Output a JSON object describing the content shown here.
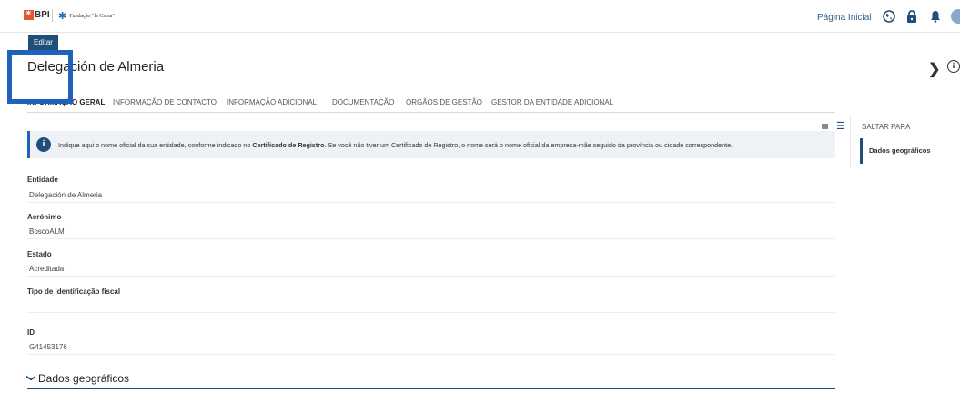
{
  "header": {
    "logo_bpi": "BPI",
    "logo_fundacao": "Fundação \"la Caixa\"",
    "home_link": "Página Inicial"
  },
  "toolbar": {
    "edit_label": "Editar"
  },
  "page": {
    "title": "Delegación de Almeria"
  },
  "tabs": [
    {
      "label": "INFORMAÇÃO GERAL",
      "active": true
    },
    {
      "label": "INFORMAÇÃO DE CONTACTO"
    },
    {
      "label": "INFORMAÇÃO ADICIONAL"
    },
    {
      "label": "DOCUMENTAÇÃO"
    },
    {
      "label": "ÓRGÃOS DE GESTÃO"
    },
    {
      "label": "GESTOR DA ENTIDADE ADICIONAL"
    }
  ],
  "alert": {
    "text_before": "Indique aqui o nome oficial da sua entidade, conforme indicado no ",
    "text_bold": "Certificado de Registro",
    "text_after": ". Se você não tiver um Certificado de Registro, o nome será o nome oficial da empresa-mãe seguido da província ou cidade correspondente."
  },
  "fields": [
    {
      "label": "Entidade",
      "value": "Delegación de Almeria"
    },
    {
      "label": "Acrónimo",
      "value": "BoscoALM"
    },
    {
      "label": "Estado",
      "value": "Acreditada"
    },
    {
      "label": "Tipo de identificação fiscal",
      "value": ""
    },
    {
      "label": "ID",
      "value": "G41453176"
    }
  ],
  "section": {
    "title": "Dados geográficos"
  },
  "side_panel": {
    "header": "SALTAR PARA",
    "items": [
      "Dados geográficos"
    ]
  },
  "colors": {
    "accent": "#1f4e79",
    "highlight": "#1f62b8",
    "alert_bg": "#eef2f6"
  }
}
